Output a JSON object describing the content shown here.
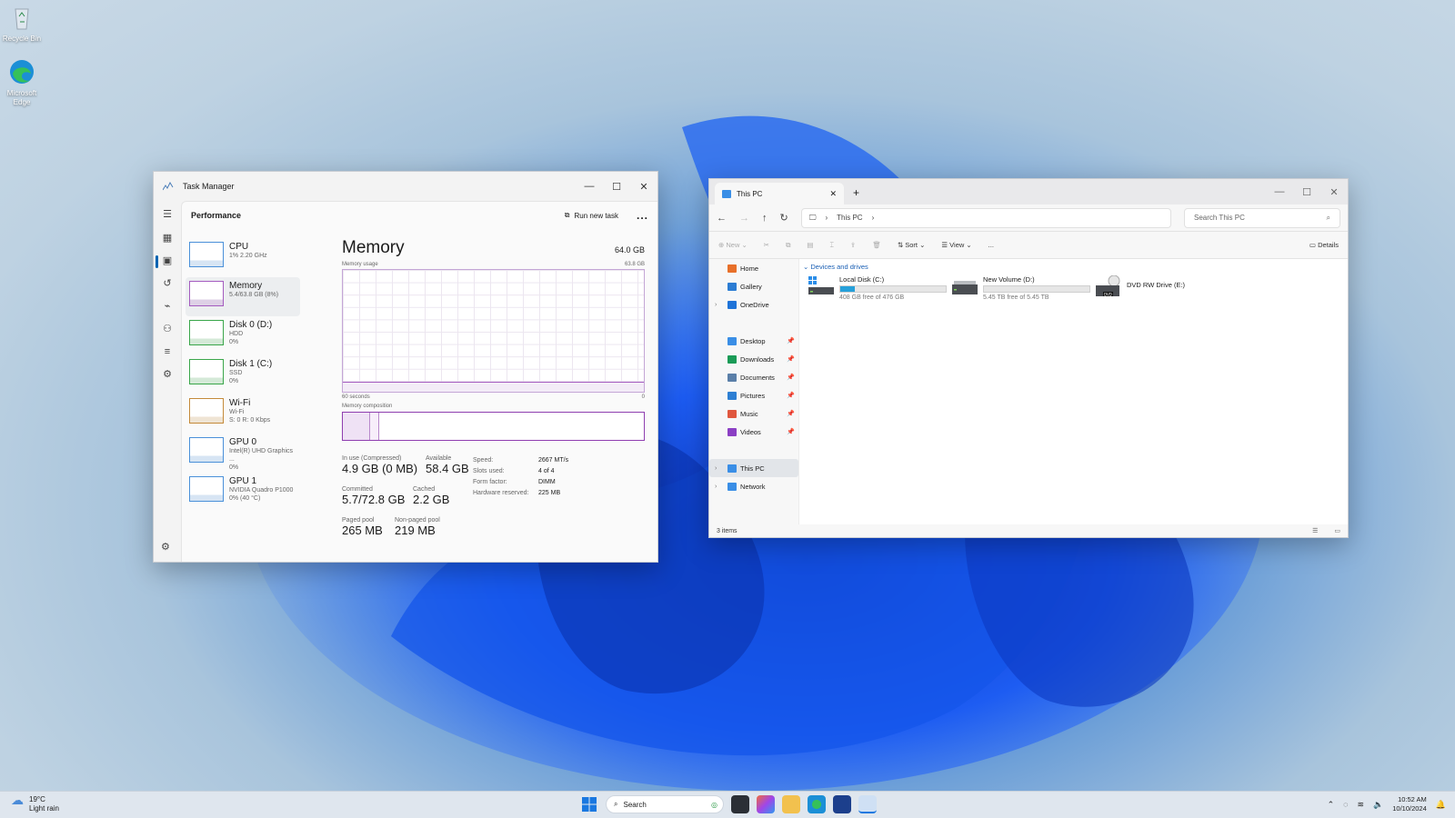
{
  "desktop": {
    "icons": [
      {
        "label": "Recycle Bin"
      },
      {
        "label": "Microsoft Edge"
      }
    ]
  },
  "task_manager": {
    "title": "Task Manager",
    "section": "Performance",
    "run_new_task": "Run new task",
    "more": "...",
    "perf_items": [
      {
        "name": "CPU",
        "sub1": "1% 2.20 GHz",
        "sub2": ""
      },
      {
        "name": "Memory",
        "sub1": "5.4/63.8 GB (8%)",
        "sub2": ""
      },
      {
        "name": "Disk 0 (D:)",
        "sub1": "HDD",
        "sub2": "0%"
      },
      {
        "name": "Disk 1 (C:)",
        "sub1": "SSD",
        "sub2": "0%"
      },
      {
        "name": "Wi-Fi",
        "sub1": "Wi-Fi",
        "sub2": "S: 0 R: 0 Kbps"
      },
      {
        "name": "GPU 0",
        "sub1": "Intel(R) UHD Graphics ...",
        "sub2": "0%"
      },
      {
        "name": "GPU 1",
        "sub1": "NVIDIA Quadro P1000",
        "sub2": "0% (40 °C)"
      }
    ],
    "memory": {
      "title": "Memory",
      "total": "64.0 GB",
      "usage_label": "Memory usage",
      "usage_max": "63.8 GB",
      "axis_left": "60 seconds",
      "axis_right": "0",
      "composition_label": "Memory composition",
      "stats": {
        "in_use_label": "In use (Compressed)",
        "in_use": "4.9 GB (0 MB)",
        "available_label": "Available",
        "available": "58.4 GB",
        "committed_label": "Committed",
        "committed": "5.7/72.8 GB",
        "cached_label": "Cached",
        "cached": "2.2 GB",
        "paged_label": "Paged pool",
        "paged": "265 MB",
        "nonpaged_label": "Non-paged pool",
        "nonpaged": "219 MB"
      },
      "details": [
        {
          "k": "Speed:",
          "v": "2667 MT/s"
        },
        {
          "k": "Slots used:",
          "v": "4 of 4"
        },
        {
          "k": "Form factor:",
          "v": "DIMM"
        },
        {
          "k": "Hardware reserved:",
          "v": "225 MB"
        }
      ]
    }
  },
  "explorer": {
    "tab_title": "This PC",
    "address": "This PC",
    "search_placeholder": "Search This PC",
    "commands": {
      "new": "New",
      "sort": "Sort",
      "view": "View",
      "more": "...",
      "details": "Details"
    },
    "nav": [
      {
        "label": "Home",
        "color": "#e8702a"
      },
      {
        "label": "Gallery",
        "color": "#2b7cd3"
      },
      {
        "label": "OneDrive",
        "color": "#1e73d8"
      },
      {
        "label": "Desktop",
        "color": "#3a8ee6"
      },
      {
        "label": "Downloads",
        "color": "#1a9b57"
      },
      {
        "label": "Documents",
        "color": "#5a7fa8"
      },
      {
        "label": "Pictures",
        "color": "#2d7fd3"
      },
      {
        "label": "Music",
        "color": "#e0573e"
      },
      {
        "label": "Videos",
        "color": "#8b3fc4"
      },
      {
        "label": "This PC",
        "color": "#3a8ee6"
      },
      {
        "label": "Network",
        "color": "#3a8ee6"
      }
    ],
    "group": "Devices and drives",
    "drives": [
      {
        "name": "Local Disk (C:)",
        "free": "408 GB free of 476 GB",
        "used_fraction": 0.14
      },
      {
        "name": "New Volume (D:)",
        "free": "5.45 TB free of 5.45 TB",
        "used_fraction": 0.0
      },
      {
        "name": "DVD RW Drive (E:)",
        "free": ""
      }
    ],
    "status": "3 items"
  },
  "taskbar": {
    "weather_temp": "19°C",
    "weather_desc": "Light rain",
    "search": "Search",
    "time": "10:52 AM",
    "date": "10/10/2024"
  }
}
